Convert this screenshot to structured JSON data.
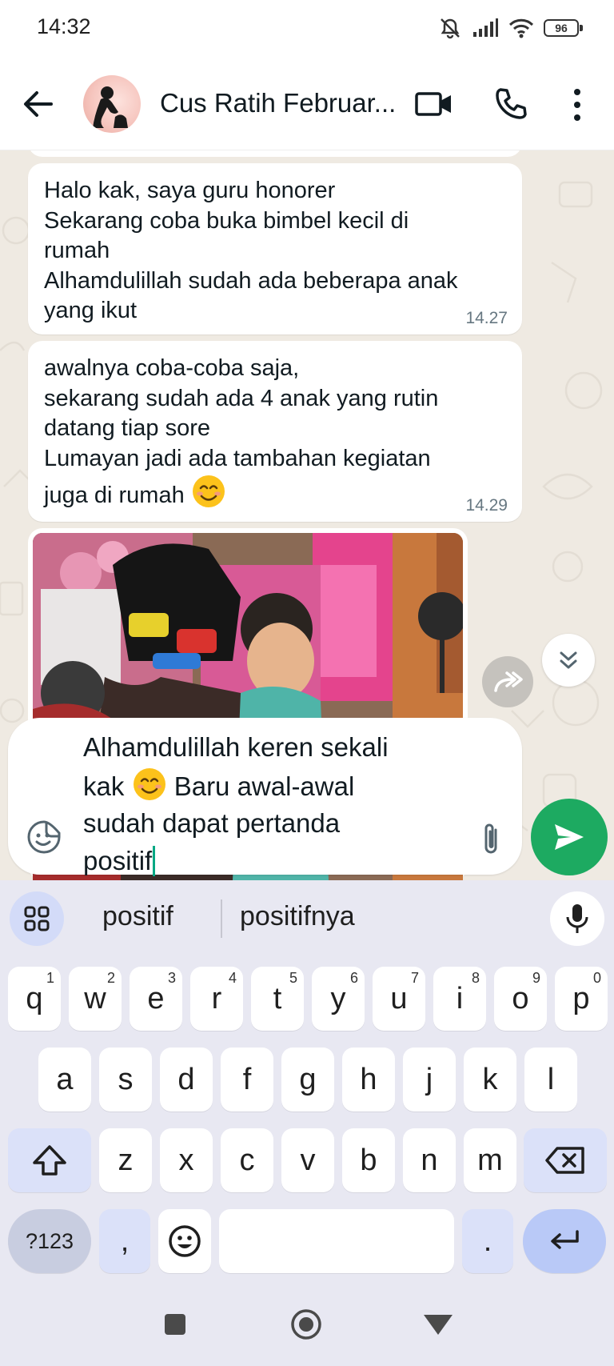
{
  "status_bar": {
    "time": "14:32",
    "battery": "96"
  },
  "header": {
    "contact_name": "Cus Ratih Februar..."
  },
  "messages": [
    {
      "lines": [
        "Halo kak, saya guru honorer",
        "Sekarang coba buka bimbel kecil di",
        "rumah",
        "Alhamdulillah sudah ada beberapa anak",
        "yang ikut"
      ],
      "time": "14.27"
    },
    {
      "lines": [
        "awalnya coba-coba saja,",
        "sekarang sudah ada 4 anak yang rutin",
        "datang tiap sore",
        "Lumayan jadi ada tambahan kegiatan",
        "juga di rumah"
      ],
      "time": "14.29"
    }
  ],
  "compose": {
    "line1": "Alhamdulillah keren sekali",
    "line2a": "kak",
    "line2b": "Baru awal-awal",
    "line3": "sudah dapat pertanda",
    "line4": "positif"
  },
  "keyboard": {
    "suggestions": [
      "positif",
      "positifnya"
    ],
    "row1": [
      {
        "k": "q",
        "h": "1"
      },
      {
        "k": "w",
        "h": "2"
      },
      {
        "k": "e",
        "h": "3"
      },
      {
        "k": "r",
        "h": "4"
      },
      {
        "k": "t",
        "h": "5"
      },
      {
        "k": "y",
        "h": "6"
      },
      {
        "k": "u",
        "h": "7"
      },
      {
        "k": "i",
        "h": "8"
      },
      {
        "k": "o",
        "h": "9"
      },
      {
        "k": "p",
        "h": "0"
      }
    ],
    "row2": [
      "a",
      "s",
      "d",
      "f",
      "g",
      "h",
      "j",
      "k",
      "l"
    ],
    "row3": [
      "z",
      "x",
      "c",
      "v",
      "b",
      "n",
      "m"
    ],
    "symbols_key": "?123",
    "comma_key": ",",
    "period_key": "."
  },
  "colors": {
    "accent": "#1daa61",
    "chat_bg": "#efeae2",
    "caret": "#00a884"
  }
}
